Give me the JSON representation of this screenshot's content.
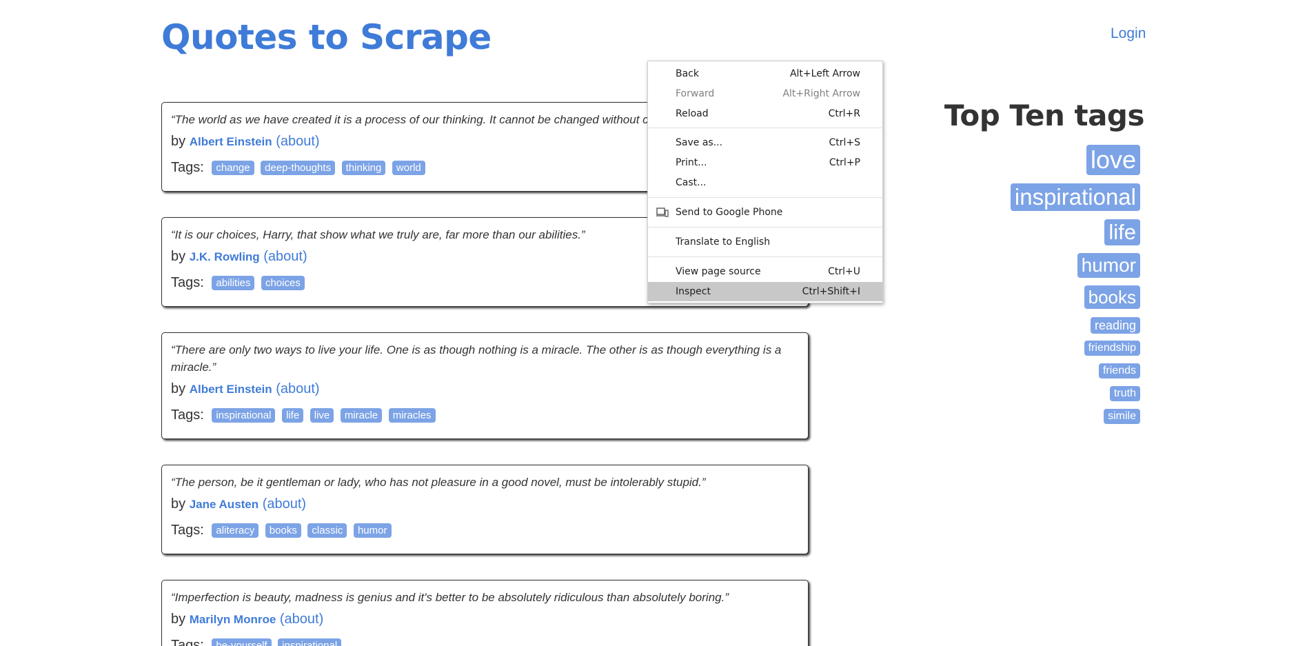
{
  "header": {
    "title": "Quotes to Scrape",
    "login": "Login"
  },
  "quotes": [
    {
      "text": "“The world as we have created it is a process of our thinking. It cannot be changed without changing our thinking.”",
      "by": "by",
      "author": "Albert Einstein",
      "about": "(about)",
      "tags_label": "Tags:",
      "tags": [
        "change",
        "deep-thoughts",
        "thinking",
        "world"
      ]
    },
    {
      "text": "“It is our choices, Harry, that show what we truly are, far more than our abilities.”",
      "by": "by",
      "author": "J.K. Rowling",
      "about": "(about)",
      "tags_label": "Tags:",
      "tags": [
        "abilities",
        "choices"
      ]
    },
    {
      "text": "“There are only two ways to live your life. One is as though nothing is a miracle. The other is as though everything is a miracle.”",
      "by": "by",
      "author": "Albert Einstein",
      "about": "(about)",
      "tags_label": "Tags:",
      "tags": [
        "inspirational",
        "life",
        "live",
        "miracle",
        "miracles"
      ]
    },
    {
      "text": "“The person, be it gentleman or lady, who has not pleasure in a good novel, must be intolerably stupid.”",
      "by": "by",
      "author": "Jane Austen",
      "about": "(about)",
      "tags_label": "Tags:",
      "tags": [
        "aliteracy",
        "books",
        "classic",
        "humor"
      ]
    },
    {
      "text": "“Imperfection is beauty, madness is genius and it's better to be absolutely ridiculous than absolutely boring.”",
      "by": "by",
      "author": "Marilyn Monroe",
      "about": "(about)",
      "tags_label": "Tags:",
      "tags": [
        "be-yourself",
        "inspirational"
      ]
    }
  ],
  "top_tags": {
    "title": "Top Ten tags",
    "tags": [
      "love",
      "inspirational",
      "life",
      "humor",
      "books",
      "reading",
      "friendship",
      "friends",
      "truth",
      "simile"
    ]
  },
  "context_menu": {
    "items": [
      {
        "label": "Back",
        "shortcut": "Alt+Left Arrow"
      },
      {
        "label": "Forward",
        "shortcut": "Alt+Right Arrow"
      },
      {
        "label": "Reload",
        "shortcut": "Ctrl+R"
      },
      {
        "label": "Save as...",
        "shortcut": "Ctrl+S"
      },
      {
        "label": "Print...",
        "shortcut": "Ctrl+P"
      },
      {
        "label": "Cast...",
        "shortcut": ""
      },
      {
        "label": "Send to Google Phone",
        "shortcut": "",
        "icon": "send-to-device-icon"
      },
      {
        "label": "Translate to English",
        "shortcut": ""
      },
      {
        "label": "View page source",
        "shortcut": "Ctrl+U"
      },
      {
        "label": "Inspect",
        "shortcut": "Ctrl+Shift+I"
      }
    ]
  },
  "colors": {
    "link": "#3f7bd8",
    "tag_bg": "#7ca3e6",
    "menu_hover": "#c8c8c8"
  }
}
